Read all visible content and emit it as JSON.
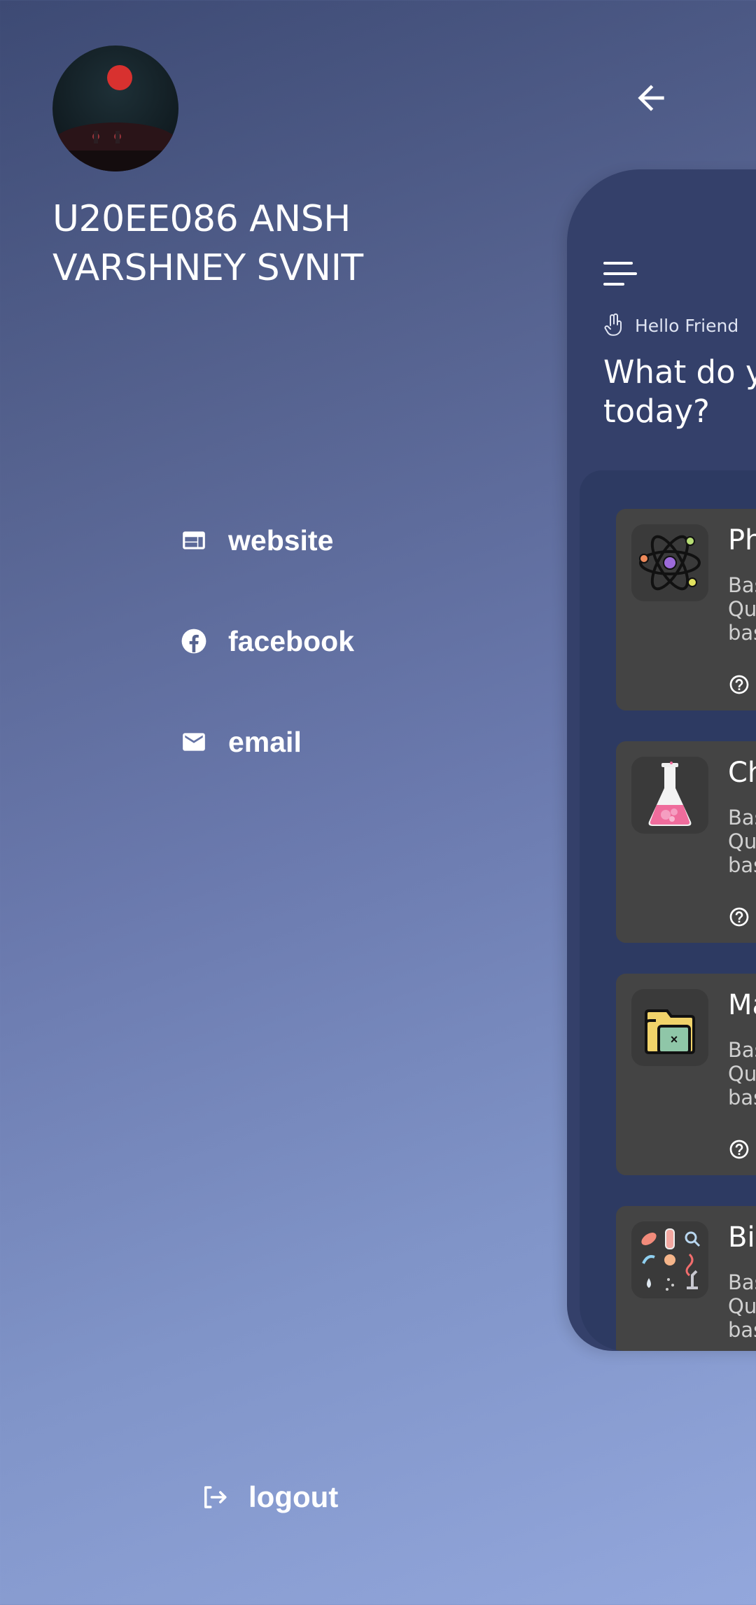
{
  "profile": {
    "name": "U20EE086 ANSH VARSHNEY SVNIT"
  },
  "drawer_menu": [
    {
      "label": "website",
      "icon": "web-icon"
    },
    {
      "label": "facebook",
      "icon": "facebook-icon"
    },
    {
      "label": "email",
      "icon": "email-icon"
    }
  ],
  "logout": {
    "label": "logout",
    "icon": "logout-icon"
  },
  "main": {
    "greeting": "Hello Friend",
    "question": "What do y today?",
    "question_line1": "What do y",
    "question_line2": "today?",
    "cards": [
      {
        "title": "Ph",
        "desc_lines": [
          "Bas",
          "Qu",
          "bas"
        ],
        "icon": "atom-icon"
      },
      {
        "title": "Ch",
        "desc_lines": [
          "Bas",
          "Qu",
          "bas"
        ],
        "icon": "flask-icon"
      },
      {
        "title": "Ma",
        "desc_lines": [
          "Bas",
          "Qu",
          "bas"
        ],
        "icon": "folder-icon"
      },
      {
        "title": "Bio",
        "desc_lines": [
          "Bas",
          "Qu",
          "bas"
        ],
        "icon": "biology-icon"
      }
    ]
  },
  "colors": {
    "gradient_top": "#3d4a74",
    "gradient_bottom": "#93a7dc",
    "panel": "#34406a",
    "inner_panel": "#2d3a62",
    "card": "#444444"
  }
}
